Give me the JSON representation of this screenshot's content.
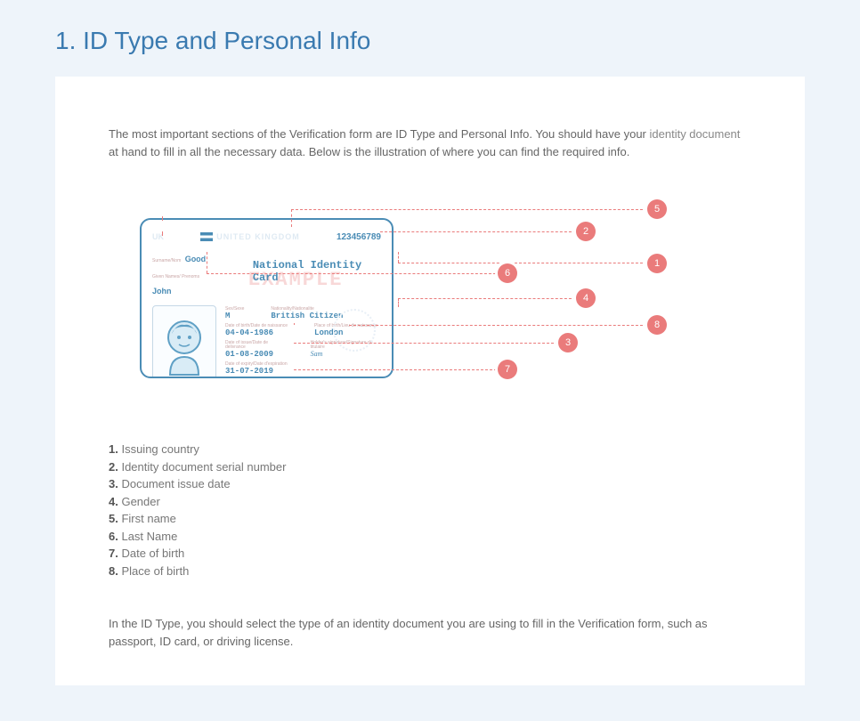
{
  "page_title": "1. ID Type and Personal Info",
  "intro": {
    "part1": "The most important sections of the Verification form are ID Type and Personal Info. You should have your ",
    "link": "identity document",
    "part2": " at hand to fill in all the necessary data. Below is the illustration of where you can find the required info."
  },
  "id_card": {
    "uk": "UK",
    "country_title": "UNITED KINGDOM",
    "serial": "123456789",
    "surname_label": "Surname/Nom",
    "surname": "Good",
    "given_label": "Given Names/ Prenoms",
    "given": "John",
    "card_type": "National Identity Card",
    "watermark": "EXAMPLE",
    "sex_label": "Sex/Sexe",
    "sex": "M",
    "nationality_label": "Nationality/Nationalite",
    "nationality": "British Citizen",
    "dob_label": "Date of birth/Date de naissance",
    "dob": "04-04-1986",
    "pob_label": "Place of birth/Lieu de naissance",
    "pob": "London",
    "doi_label": "Date of issue/Date de delivrance",
    "doi": "01-08-2009",
    "sig_label": "Holder's signature/Signature du titulaire",
    "sig": "Sam",
    "doe_label": "Date of expiry/Date d'expiration",
    "doe": "31-07-2019"
  },
  "markers": {
    "m1": "1",
    "m2": "2",
    "m3": "3",
    "m4": "4",
    "m5": "5",
    "m6": "6",
    "m7": "7",
    "m8": "8"
  },
  "legend": [
    "Issuing country",
    "Identity document serial number",
    "Document issue date",
    "Gender",
    "First name",
    "Last Name",
    "Date of birth",
    "Place of birth"
  ],
  "legend_nums": [
    "1.",
    "2.",
    "3.",
    "4.",
    "5.",
    "6.",
    "7.",
    "8."
  ],
  "closing": "In the ID Type, you should select the type of an identity document you are using to fill in the Verification form, such as passport, ID card, or driving license."
}
